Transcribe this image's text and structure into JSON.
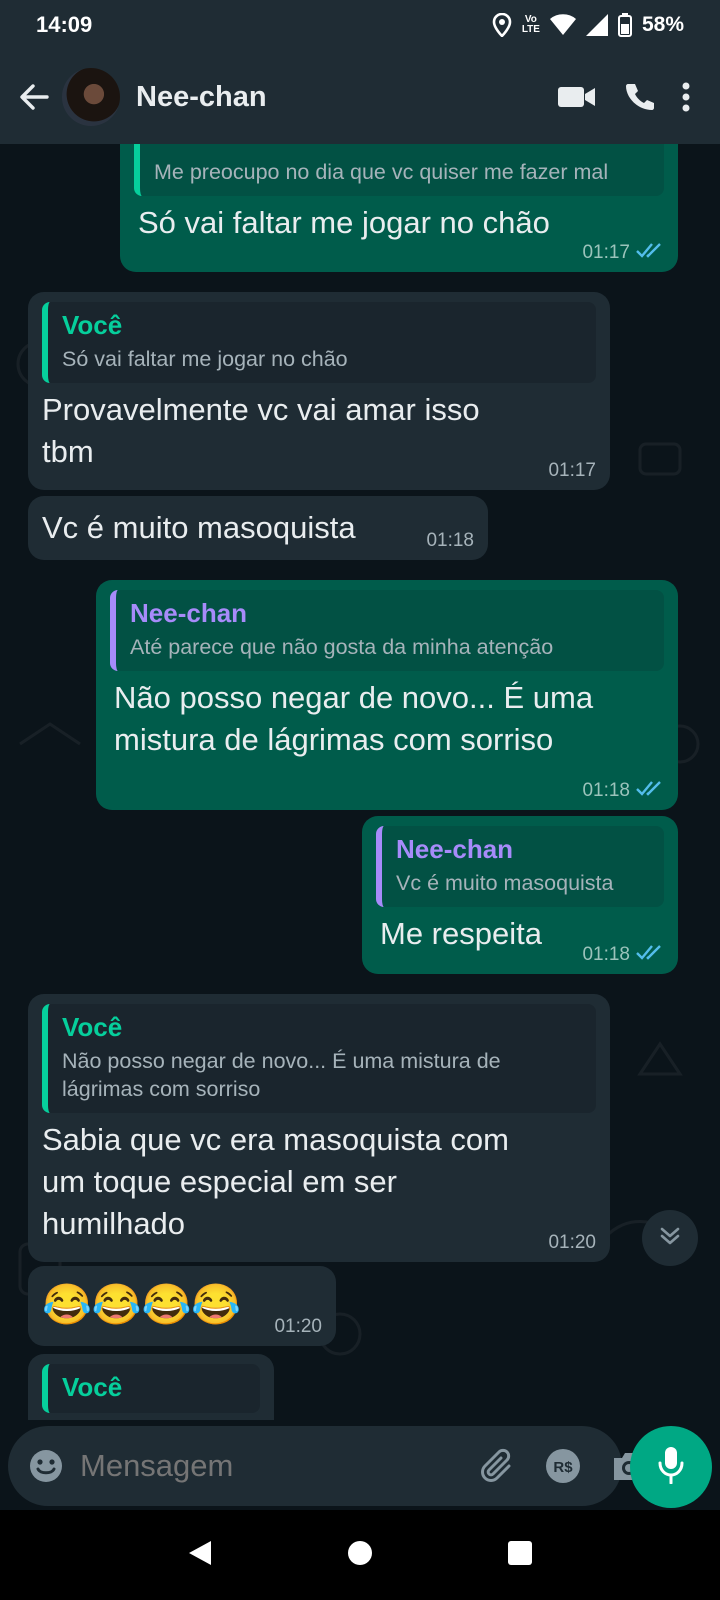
{
  "status": {
    "time": "14:09",
    "lte_top": "Vo",
    "lte_bottom": "LTE",
    "battery": "58%"
  },
  "header": {
    "contact_name": "Nee-chan"
  },
  "messages": [
    {
      "quote_text": "Me preocupo no dia que vc quiser me fazer mal",
      "text": "Só vai faltar me jogar no chão",
      "time": "01:17"
    },
    {
      "quote_author": "Você",
      "quote_text": "Só vai faltar me jogar no chão",
      "text": "Provavelmente vc vai amar isso tbm",
      "time": "01:17"
    },
    {
      "text": "Vc é muito masoquista",
      "time": "01:18"
    },
    {
      "quote_author": "Nee-chan",
      "quote_text": "Até parece que não gosta  da minha atenção",
      "text": "Não posso negar de novo... É uma mistura de lágrimas com sorriso",
      "time": "01:18"
    },
    {
      "quote_author": "Nee-chan",
      "quote_text": "Vc é muito masoquista",
      "text": "Me respeita",
      "time": "01:18"
    },
    {
      "quote_author": "Você",
      "quote_text": "Não posso negar de novo... É uma mistura de lágrimas com sorriso",
      "text": "Sabia que vc era masoquista com um toque especial em ser humilhado",
      "time": "01:20"
    },
    {
      "text": "😂😂😂😂",
      "time": "01:20"
    },
    {
      "quote_author": "Você"
    }
  ],
  "composer": {
    "placeholder": "Mensagem"
  },
  "colors": {
    "header_bg": "#1f2c34",
    "chat_bg": "#0b141a",
    "outgoing_bubble": "#005c4b",
    "incoming_bubble": "#1f2c34",
    "accent": "#00a884",
    "quote_you": "#06cf9c",
    "quote_contact": "#a78bfa",
    "read_ticks": "#53bdeb"
  },
  "icons": [
    "back-arrow-icon",
    "video-call-icon",
    "phone-icon",
    "more-options-icon",
    "emoji-icon",
    "attach-icon",
    "payment-icon",
    "camera-icon",
    "mic-icon",
    "chevron-down-icon",
    "nav-back-icon",
    "nav-home-icon",
    "nav-recents-icon"
  ]
}
